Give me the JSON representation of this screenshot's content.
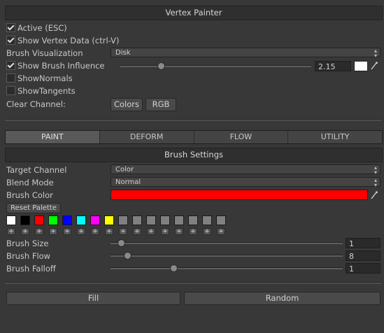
{
  "header": {
    "title": "Vertex Painter"
  },
  "top": {
    "active_label": "Active (ESC)",
    "show_vertex_label": "Show Vertex Data (ctrl-V)",
    "brush_vis_label": "Brush Visualization",
    "brush_vis_value": "Disk",
    "show_influence_label": "Show Brush Influence",
    "influence_value": "2.15",
    "show_normals_label": "ShowNormals",
    "show_tangents_label": "ShowTangents",
    "clear_channel_label": "Clear Channel:",
    "colors_btn": "Colors",
    "rgb_btn": "RGB"
  },
  "tabs": [
    "PAINT",
    "DEFORM",
    "FLOW",
    "UTILITY"
  ],
  "brush": {
    "section_title": "Brush Settings",
    "target_channel_label": "Target Channel",
    "target_channel_value": "Color",
    "blend_mode_label": "Blend Mode",
    "blend_mode_value": "Normal",
    "brush_color_label": "Brush Color",
    "brush_color": "#ff0000",
    "reset_palette": "Reset Palette",
    "palette": [
      "#ffffff",
      "#000000",
      "#ff0000",
      "#00ff00",
      "#0000ff",
      "#00ffff",
      "#ff00ff",
      "#ffff00",
      "#808080",
      "#808080",
      "#808080",
      "#808080",
      "#808080",
      "#808080",
      "#808080",
      "#808080"
    ],
    "plus_label": "+",
    "size_label": "Brush Size",
    "size_value": "1",
    "flow_label": "Brush Flow",
    "flow_value": "8",
    "falloff_label": "Brush Falloff",
    "falloff_value": "1"
  },
  "bottom": {
    "fill": "Fill",
    "random": "Random"
  }
}
